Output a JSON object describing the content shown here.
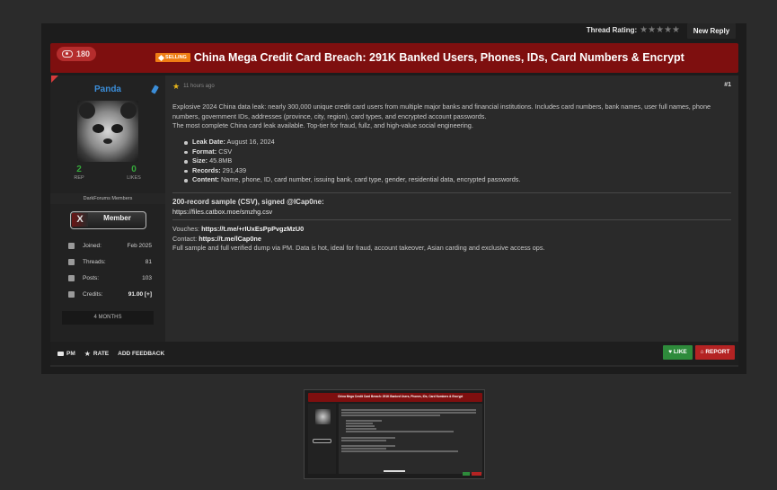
{
  "topbar": {
    "thread_rating_label": "Thread Rating:",
    "stars": "★★★★★",
    "new_reply": "New Reply"
  },
  "thread": {
    "views": "180",
    "tag": "SELLING",
    "title": "China Mega Credit Card Breach: 291K Banked Users, Phones, IDs, Card Numbers & Encrypt"
  },
  "user": {
    "name": "Panda",
    "rep": "2",
    "rep_label": "REP",
    "likes": "0",
    "likes_label": "LIKES",
    "group": "DarkForums Members",
    "badge": "Member",
    "badge_mark": "X",
    "stats": [
      {
        "label": "Joined:",
        "value": "Feb 2025"
      },
      {
        "label": "Threads:",
        "value": "81"
      },
      {
        "label": "Posts:",
        "value": "103"
      },
      {
        "label": "Credits:",
        "value": "91.00 [+]"
      }
    ],
    "tenure": "4 MONTHS"
  },
  "post": {
    "time": "11 hours ago",
    "number": "#1",
    "intro_1": "Explosive 2024 China data leak: nearly 300,000 unique credit card users from multiple major banks and financial institutions. Includes card numbers, bank names, user full names, phone numbers, government IDs, addresses (province, city, region), card types, and encrypted account passwords.",
    "intro_2": "The most complete China card leak available. Top-tier for fraud, fullz, and high-value social engineering.",
    "bullets": [
      {
        "label": "Leak Date:",
        "value": "August 16, 2024"
      },
      {
        "label": "Format:",
        "value": "CSV"
      },
      {
        "label": "Size:",
        "value": "45.8MB"
      },
      {
        "label": "Records:",
        "value": "291,439"
      },
      {
        "label": "Content:",
        "value": "Name, phone, ID, card number, issuing bank, card type, gender, residential data, encrypted passwords."
      }
    ],
    "sample_title": "200-record sample (CSV), signed @lCap0ne:",
    "sample_link": "https://files.catbox.moe/smzhg.csv",
    "vouches_label": "Vouches:",
    "vouches_link": "https://t.me/+rIUxEsPpPvgzMzU0",
    "contact_label": "Contact:",
    "contact_link": "https://t.me/lCap0ne",
    "closing": "Full sample and full verified dump via PM. Data is hot, ideal for fraud, account takeover, Asian carding and exclusive access ops."
  },
  "footer": {
    "pm": "PM",
    "rate": "RATE",
    "feedback": "ADD FEEDBACK",
    "like": "LIKE",
    "report": "REPORT"
  },
  "colors": {
    "accent_red": "#7e0f0f",
    "username_blue": "#3b8dd8",
    "like_green": "#2e8b3b",
    "report_red": "#b42323",
    "tag_orange": "#f07d14"
  },
  "icons": [
    "eye-icon",
    "tag-icon",
    "verified-icon",
    "calendar-icon",
    "threads-icon",
    "posts-icon",
    "credits-icon",
    "pm-icon",
    "star-icon",
    "heart-icon",
    "home-icon"
  ]
}
